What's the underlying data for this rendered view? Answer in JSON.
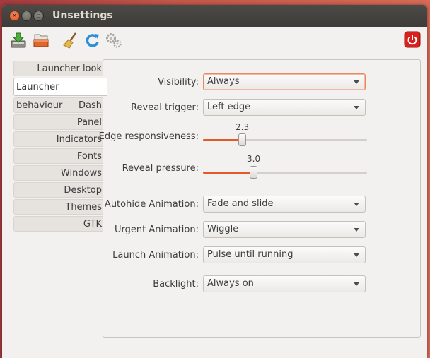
{
  "window": {
    "title": "Unsettings"
  },
  "toolbar": {
    "buttons": [
      {
        "icon": "save-download-icon"
      },
      {
        "icon": "open-folder-icon"
      },
      {
        "icon": "broom-clean-icon"
      },
      {
        "icon": "refresh-icon"
      },
      {
        "icon": "gears-settings-icon"
      },
      {
        "icon": "power-icon"
      }
    ]
  },
  "sidebar": {
    "tabs": [
      {
        "label": "Launcher look"
      },
      {
        "label": "Launcher behaviour"
      },
      {
        "label": "Dash"
      },
      {
        "label": "Panel"
      },
      {
        "label": "Indicators"
      },
      {
        "label": "Fonts"
      },
      {
        "label": "Windows"
      },
      {
        "label": "Desktop"
      },
      {
        "label": "Themes"
      },
      {
        "label": "GTK"
      }
    ],
    "active_tab": "Launcher behaviour"
  },
  "settings": {
    "visibility": {
      "label": "Visibility:",
      "value": "Always"
    },
    "reveal_trigger": {
      "label": "Reveal trigger:",
      "value": "Left edge"
    },
    "edge_responsiveness": {
      "label": "Edge responsiveness:",
      "value": "2.3"
    },
    "reveal_pressure": {
      "label": "Reveal pressure:",
      "value": "3.0"
    },
    "autohide_animation": {
      "label": "Autohide Animation:",
      "value": "Fade and slide"
    },
    "urgent_animation": {
      "label": "Urgent Animation:",
      "value": "Wiggle"
    },
    "launch_animation": {
      "label": "Launch Animation:",
      "value": "Pulse until running"
    },
    "backlight": {
      "label": "Backlight:",
      "value": "Always on"
    }
  },
  "sliders": {
    "edge_responsiveness_fraction": 0.24,
    "reveal_pressure_fraction": 0.31
  },
  "colors": {
    "accent": "#e05a2a",
    "focus": "#e98a5e"
  }
}
